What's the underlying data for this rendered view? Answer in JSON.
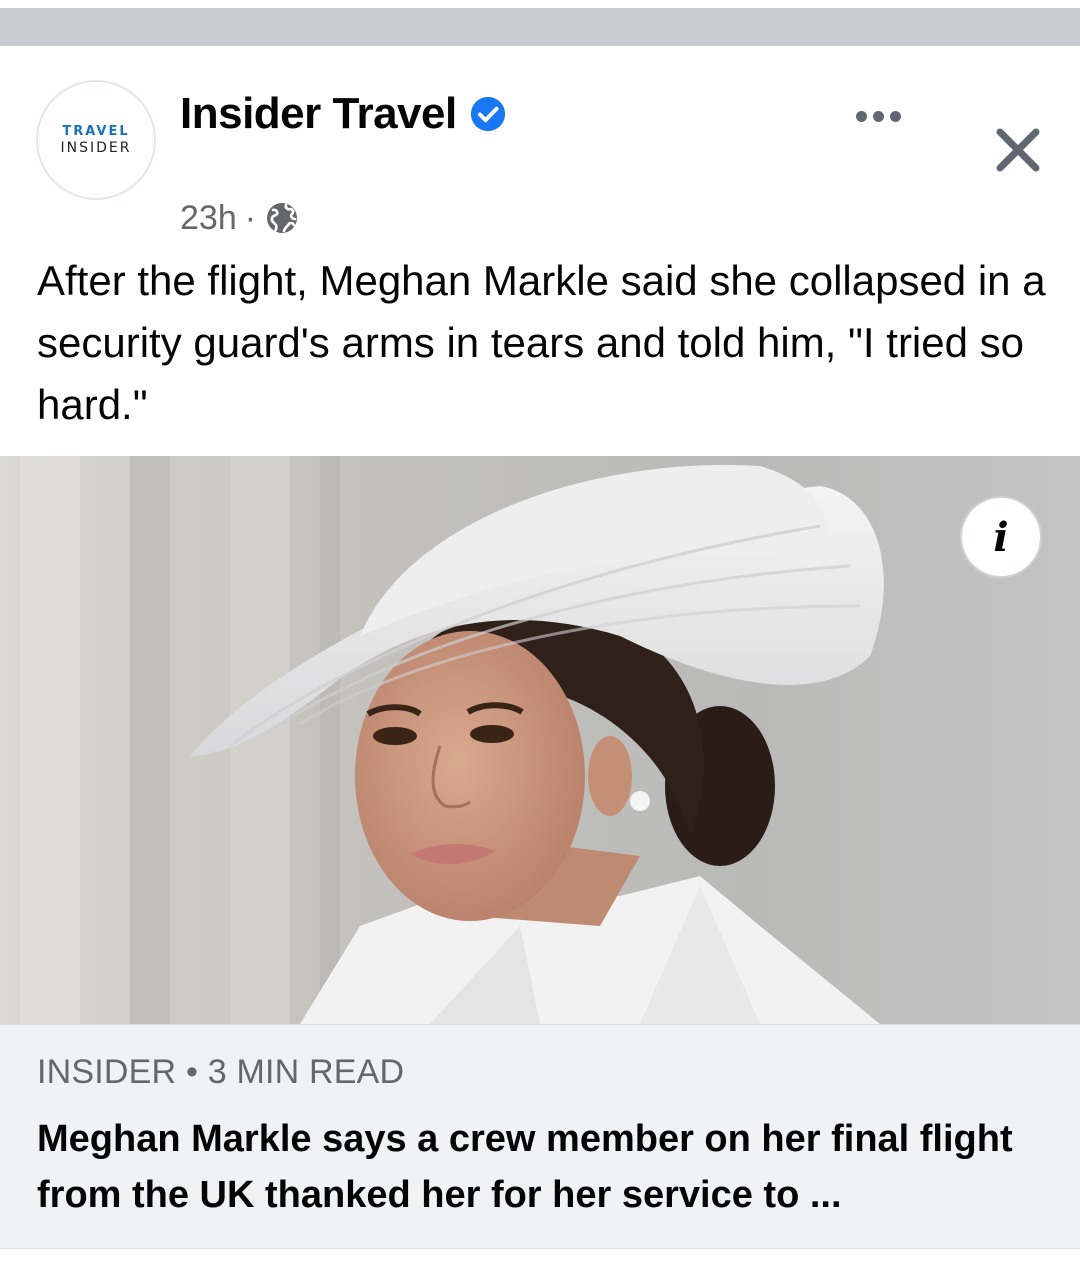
{
  "post": {
    "page_name": "Insider Travel",
    "avatar": {
      "line1": "TRAVEL",
      "line2": "INSIDER"
    },
    "timestamp": "23h",
    "separator": "·",
    "privacy_icon": "globe-icon",
    "verified_icon": "verified-badge-icon",
    "more_icon": "more-options-icon",
    "close_icon": "close-icon",
    "text": "After the flight, Meghan Markle said she collapsed in a security guard's arms in tears and told him, \"I tried so hard.\""
  },
  "link": {
    "info_label": "i",
    "domain": "INSIDER • 3 MIN READ",
    "title": "Meghan Markle says a crew member on her final flight from the UK thanked her for her service to ..."
  },
  "colors": {
    "verified_blue": "#1877f2",
    "meta_gray": "#65676b",
    "footer_bg": "#f0f2f5"
  }
}
